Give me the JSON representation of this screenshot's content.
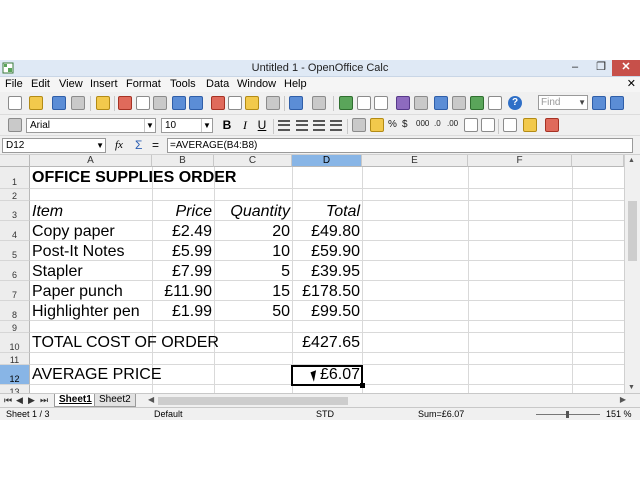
{
  "window": {
    "title": "Untitled 1 - OpenOffice Calc",
    "minimize": "–",
    "maximize": "❐",
    "close": "✕"
  },
  "menu": {
    "items": [
      "File",
      "Edit",
      "View",
      "Insert",
      "Format",
      "Tools",
      "Data",
      "Window",
      "Help"
    ],
    "close_doc": "✕"
  },
  "toolbar": {
    "find_placeholder": "Find"
  },
  "format_bar": {
    "font_name": "Arial",
    "font_size": "10",
    "bold": "B",
    "italic": "I",
    "underline": "U",
    "percent": "%",
    "currency": "$",
    "thousands": "000",
    "decimal_add": ".0",
    "decimal_remove": ".00"
  },
  "formula_bar": {
    "cell_ref": "D12",
    "fx": "fx",
    "sum": "Σ",
    "equals": "=",
    "formula": "=AVERAGE(B4:B8)"
  },
  "grid": {
    "columns": [
      "A",
      "B",
      "C",
      "D",
      "E",
      "F"
    ],
    "selected_column": "D",
    "rows": [
      "1",
      "2",
      "3",
      "4",
      "5",
      "6",
      "7",
      "8",
      "9",
      "10",
      "11",
      "12",
      "13"
    ],
    "selected_row": "12",
    "cells": {
      "a1": "OFFICE SUPPLIES ORDER",
      "a3": "Item",
      "b3": "Price",
      "c3": "Quantity",
      "d3": "Total",
      "items": [
        {
          "item": "Copy paper",
          "price": "£2.49",
          "qty": "20",
          "total": "£49.80"
        },
        {
          "item": "Post-It Notes",
          "price": "£5.99",
          "qty": "10",
          "total": "£59.90"
        },
        {
          "item": "Stapler",
          "price": "£7.99",
          "qty": "5",
          "total": "£39.95"
        },
        {
          "item": "Paper punch",
          "price": "£11.90",
          "qty": "15",
          "total": "£178.50"
        },
        {
          "item": "Highlighter pen",
          "price": "£1.99",
          "qty": "50",
          "total": "£99.50"
        }
      ],
      "a10": "TOTAL COST OF ORDER",
      "d10": "£427.65",
      "a12": "AVERAGE PRICE",
      "d12": "£6.07"
    }
  },
  "sheets": {
    "tabs": [
      "Sheet1",
      "Sheet2"
    ],
    "active": "Sheet1"
  },
  "status": {
    "sheet_pos": "Sheet 1 / 3",
    "page_style": "Default",
    "mode": "STD",
    "sum": "Sum=£6.07",
    "zoom": "151 %",
    "zoom_level_percent": 151
  }
}
